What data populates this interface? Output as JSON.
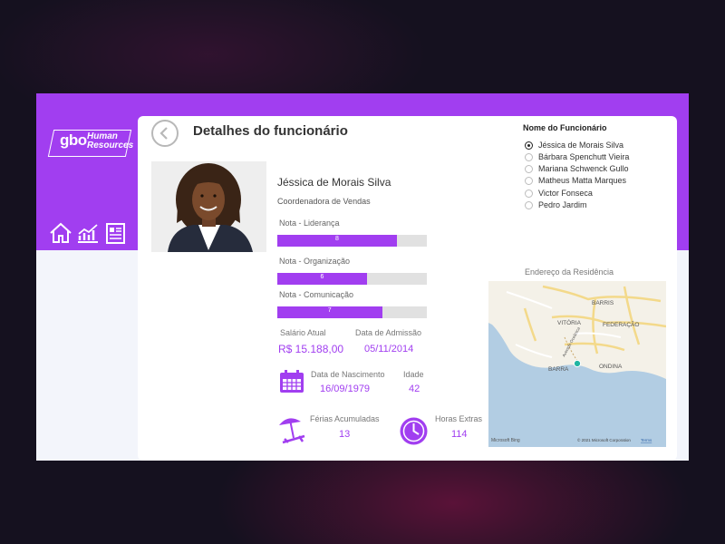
{
  "logo": {
    "brand": "gbo",
    "line1": "Human",
    "line2": "Resources"
  },
  "nav": {
    "icons": [
      "home-icon",
      "chart-icon",
      "document-icon"
    ]
  },
  "page": {
    "title": "Detalhes do funcionário"
  },
  "employee": {
    "name": "Jéssica de Morais Silva",
    "role": "Coordenadora de Vendas"
  },
  "notes": [
    {
      "label": "Nota - Liderança",
      "value": "8",
      "fraction": 0.8
    },
    {
      "label": "Nota - Organização",
      "value": "6",
      "fraction": 0.6
    },
    {
      "label": "Nota - Comunicação",
      "value": "7",
      "fraction": 0.7
    }
  ],
  "info": {
    "salary_label": "Salário Atual",
    "salary": "R$ 15.188,00",
    "admission_label": "Data de Admissão",
    "admission": "05/11/2014",
    "birth_label": "Data de Nascimento",
    "birth": "16/09/1979",
    "age_label": "Idade",
    "age": "42",
    "vacation_label": "Férias Acumuladas",
    "vacation": "13",
    "overtime_label": "Horas Extras",
    "overtime": "114"
  },
  "slicer": {
    "title": "Nome do Funcionário",
    "options": [
      {
        "label": "Jéssica de Morais Silva",
        "selected": true
      },
      {
        "label": "Bárbara Spenchutt Vieira",
        "selected": false
      },
      {
        "label": "Mariana Schwenck Gullo",
        "selected": false
      },
      {
        "label": "Matheus Matta Marques",
        "selected": false
      },
      {
        "label": "Victor Fonseca",
        "selected": false
      },
      {
        "label": "Pedro Jardim",
        "selected": false
      }
    ]
  },
  "map": {
    "title": "Endereço da Residência",
    "places": [
      "BARRIS",
      "VITÓRIA",
      "FEDERAÇÃO",
      "BARRA",
      "ONDINA"
    ],
    "street": "Avenida Oceânica",
    "brand": "Microsoft Bing",
    "copyright": "© 2021 Microsoft Corporation",
    "terms": "Terms"
  },
  "colors": {
    "accent": "#a13ef0",
    "map_pin": "#1fb5a2",
    "sea": "#b2cde3"
  }
}
